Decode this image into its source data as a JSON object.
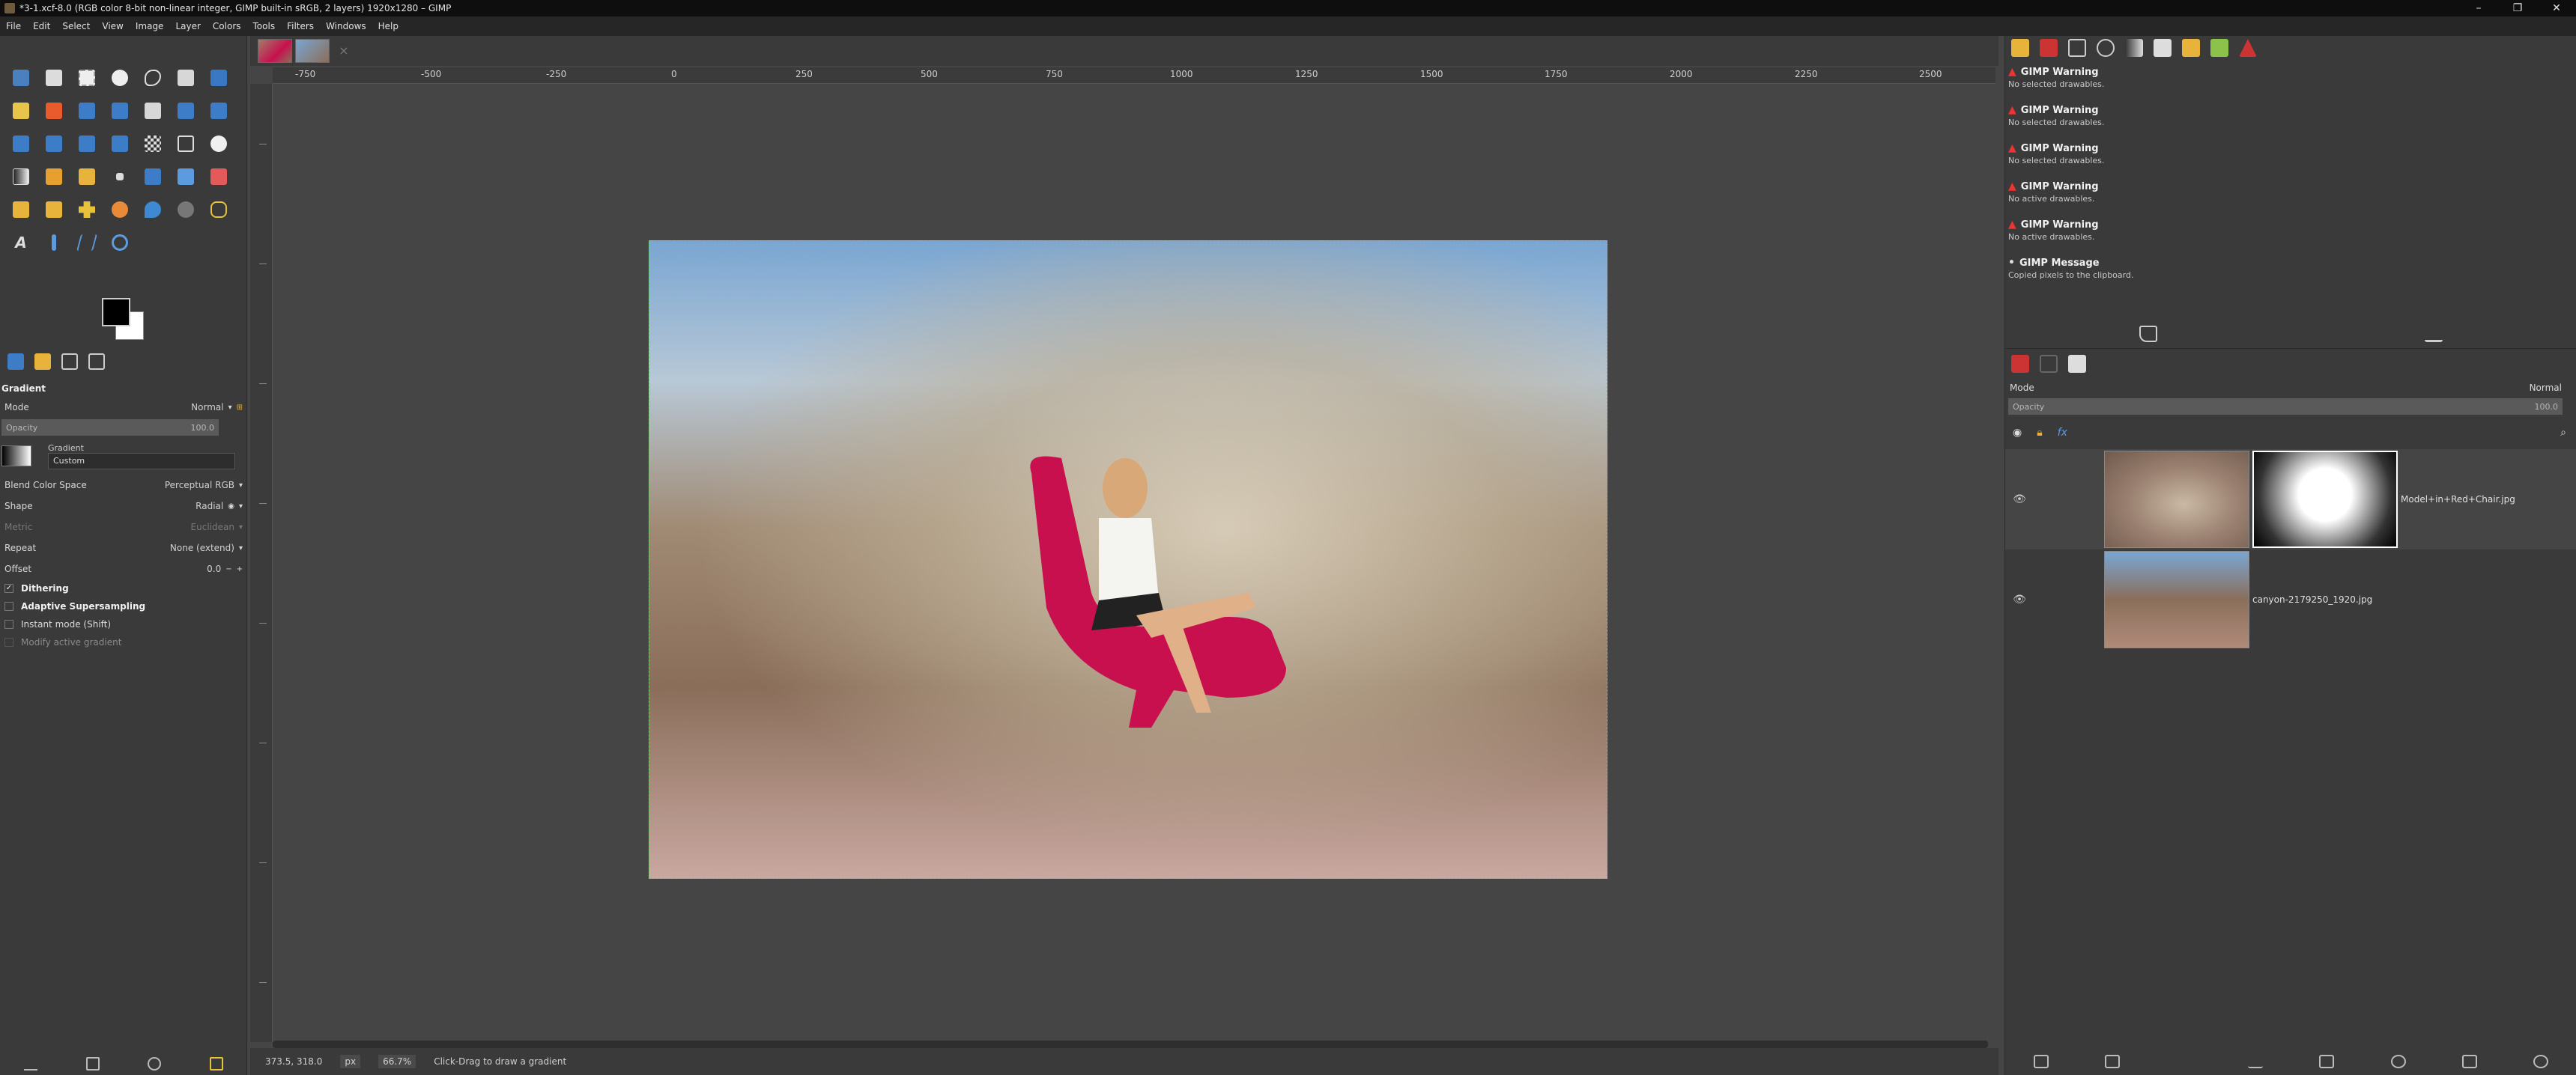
{
  "window": {
    "title": "*3-1.xcf-8.0 (RGB color 8-bit non-linear integer, GIMP built-in sRGB, 2 layers) 1920x1280 – GIMP",
    "controls": [
      "–",
      "❐",
      "✕"
    ]
  },
  "menu": [
    "File",
    "Edit",
    "Select",
    "View",
    "Image",
    "Layer",
    "Colors",
    "Tools",
    "Filters",
    "Windows",
    "Help"
  ],
  "tool_options": {
    "title": "Gradient",
    "mode_label": "Mode",
    "mode_value": "Normal",
    "opacity_label": "Opacity",
    "opacity_value": "100.0",
    "gradient_label": "Gradient",
    "gradient_value": "Custom",
    "blend_label": "Blend Color Space",
    "blend_value": "Perceptual RGB",
    "shape_label": "Shape",
    "shape_value": "Radial",
    "metric_label": "Metric",
    "metric_value": "Euclidean",
    "repeat_label": "Repeat",
    "repeat_value": "None (extend)",
    "offset_label": "Offset",
    "offset_value": "0.0",
    "dithering": "Dithering",
    "adaptive": "Adaptive Supersampling",
    "instant": "Instant mode  (Shift)",
    "modify": "Modify active gradient"
  },
  "ruler": [
    "-750",
    "-500",
    "-250",
    "0",
    "250",
    "500",
    "750",
    "1000",
    "1250",
    "1500",
    "1750",
    "2000",
    "2250",
    "2500"
  ],
  "status": {
    "coords": "373.5, 318.0",
    "unit": "px",
    "zoom": "66.7%",
    "hint": "Click-Drag to draw a gradient"
  },
  "errors": [
    {
      "title": "GIMP Warning",
      "msg": "No selected drawables."
    },
    {
      "title": "GIMP Warning",
      "msg": "No selected drawables."
    },
    {
      "title": "GIMP Warning",
      "msg": "No selected drawables."
    },
    {
      "title": "GIMP Warning",
      "msg": "No active drawables."
    },
    {
      "title": "GIMP Warning",
      "msg": "No active drawables."
    },
    {
      "title": "GIMP Message",
      "msg": "Copied pixels to the clipboard."
    }
  ],
  "layers_panel": {
    "mode_label": "Mode",
    "mode_value": "Normal",
    "opacity_label": "Opacity",
    "opacity_value": "100.0",
    "layers": [
      {
        "name": "Model+in+Red+Chair.jpg"
      },
      {
        "name": "canyon-2179250_1920.jpg"
      }
    ]
  },
  "colors": {
    "accent": "#6fcf6f",
    "warning": "#e33333",
    "chair": "#c8104e"
  }
}
